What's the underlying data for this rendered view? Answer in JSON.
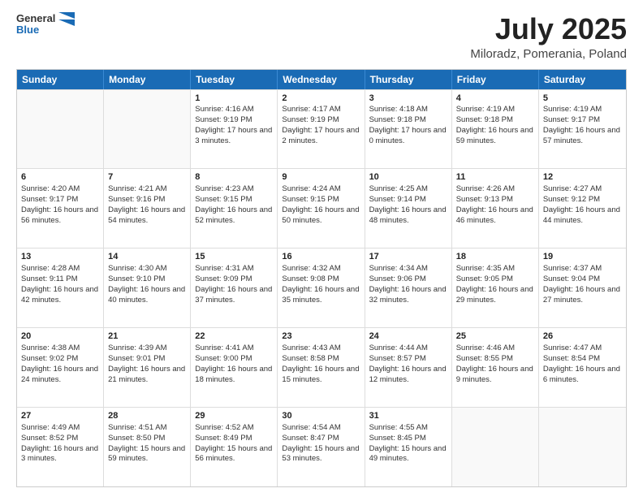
{
  "header": {
    "logo_line1": "General",
    "logo_line2": "Blue",
    "month": "July 2025",
    "location": "Miloradz, Pomerania, Poland"
  },
  "days_of_week": [
    "Sunday",
    "Monday",
    "Tuesday",
    "Wednesday",
    "Thursday",
    "Friday",
    "Saturday"
  ],
  "weeks": [
    [
      {
        "day": "",
        "sunrise": "",
        "sunset": "",
        "daylight": "",
        "empty": true
      },
      {
        "day": "",
        "sunrise": "",
        "sunset": "",
        "daylight": "",
        "empty": true
      },
      {
        "day": "1",
        "sunrise": "Sunrise: 4:16 AM",
        "sunset": "Sunset: 9:19 PM",
        "daylight": "Daylight: 17 hours and 3 minutes.",
        "empty": false
      },
      {
        "day": "2",
        "sunrise": "Sunrise: 4:17 AM",
        "sunset": "Sunset: 9:19 PM",
        "daylight": "Daylight: 17 hours and 2 minutes.",
        "empty": false
      },
      {
        "day": "3",
        "sunrise": "Sunrise: 4:18 AM",
        "sunset": "Sunset: 9:18 PM",
        "daylight": "Daylight: 17 hours and 0 minutes.",
        "empty": false
      },
      {
        "day": "4",
        "sunrise": "Sunrise: 4:19 AM",
        "sunset": "Sunset: 9:18 PM",
        "daylight": "Daylight: 16 hours and 59 minutes.",
        "empty": false
      },
      {
        "day": "5",
        "sunrise": "Sunrise: 4:19 AM",
        "sunset": "Sunset: 9:17 PM",
        "daylight": "Daylight: 16 hours and 57 minutes.",
        "empty": false
      }
    ],
    [
      {
        "day": "6",
        "sunrise": "Sunrise: 4:20 AM",
        "sunset": "Sunset: 9:17 PM",
        "daylight": "Daylight: 16 hours and 56 minutes.",
        "empty": false
      },
      {
        "day": "7",
        "sunrise": "Sunrise: 4:21 AM",
        "sunset": "Sunset: 9:16 PM",
        "daylight": "Daylight: 16 hours and 54 minutes.",
        "empty": false
      },
      {
        "day": "8",
        "sunrise": "Sunrise: 4:23 AM",
        "sunset": "Sunset: 9:15 PM",
        "daylight": "Daylight: 16 hours and 52 minutes.",
        "empty": false
      },
      {
        "day": "9",
        "sunrise": "Sunrise: 4:24 AM",
        "sunset": "Sunset: 9:15 PM",
        "daylight": "Daylight: 16 hours and 50 minutes.",
        "empty": false
      },
      {
        "day": "10",
        "sunrise": "Sunrise: 4:25 AM",
        "sunset": "Sunset: 9:14 PM",
        "daylight": "Daylight: 16 hours and 48 minutes.",
        "empty": false
      },
      {
        "day": "11",
        "sunrise": "Sunrise: 4:26 AM",
        "sunset": "Sunset: 9:13 PM",
        "daylight": "Daylight: 16 hours and 46 minutes.",
        "empty": false
      },
      {
        "day": "12",
        "sunrise": "Sunrise: 4:27 AM",
        "sunset": "Sunset: 9:12 PM",
        "daylight": "Daylight: 16 hours and 44 minutes.",
        "empty": false
      }
    ],
    [
      {
        "day": "13",
        "sunrise": "Sunrise: 4:28 AM",
        "sunset": "Sunset: 9:11 PM",
        "daylight": "Daylight: 16 hours and 42 minutes.",
        "empty": false
      },
      {
        "day": "14",
        "sunrise": "Sunrise: 4:30 AM",
        "sunset": "Sunset: 9:10 PM",
        "daylight": "Daylight: 16 hours and 40 minutes.",
        "empty": false
      },
      {
        "day": "15",
        "sunrise": "Sunrise: 4:31 AM",
        "sunset": "Sunset: 9:09 PM",
        "daylight": "Daylight: 16 hours and 37 minutes.",
        "empty": false
      },
      {
        "day": "16",
        "sunrise": "Sunrise: 4:32 AM",
        "sunset": "Sunset: 9:08 PM",
        "daylight": "Daylight: 16 hours and 35 minutes.",
        "empty": false
      },
      {
        "day": "17",
        "sunrise": "Sunrise: 4:34 AM",
        "sunset": "Sunset: 9:06 PM",
        "daylight": "Daylight: 16 hours and 32 minutes.",
        "empty": false
      },
      {
        "day": "18",
        "sunrise": "Sunrise: 4:35 AM",
        "sunset": "Sunset: 9:05 PM",
        "daylight": "Daylight: 16 hours and 29 minutes.",
        "empty": false
      },
      {
        "day": "19",
        "sunrise": "Sunrise: 4:37 AM",
        "sunset": "Sunset: 9:04 PM",
        "daylight": "Daylight: 16 hours and 27 minutes.",
        "empty": false
      }
    ],
    [
      {
        "day": "20",
        "sunrise": "Sunrise: 4:38 AM",
        "sunset": "Sunset: 9:02 PM",
        "daylight": "Daylight: 16 hours and 24 minutes.",
        "empty": false
      },
      {
        "day": "21",
        "sunrise": "Sunrise: 4:39 AM",
        "sunset": "Sunset: 9:01 PM",
        "daylight": "Daylight: 16 hours and 21 minutes.",
        "empty": false
      },
      {
        "day": "22",
        "sunrise": "Sunrise: 4:41 AM",
        "sunset": "Sunset: 9:00 PM",
        "daylight": "Daylight: 16 hours and 18 minutes.",
        "empty": false
      },
      {
        "day": "23",
        "sunrise": "Sunrise: 4:43 AM",
        "sunset": "Sunset: 8:58 PM",
        "daylight": "Daylight: 16 hours and 15 minutes.",
        "empty": false
      },
      {
        "day": "24",
        "sunrise": "Sunrise: 4:44 AM",
        "sunset": "Sunset: 8:57 PM",
        "daylight": "Daylight: 16 hours and 12 minutes.",
        "empty": false
      },
      {
        "day": "25",
        "sunrise": "Sunrise: 4:46 AM",
        "sunset": "Sunset: 8:55 PM",
        "daylight": "Daylight: 16 hours and 9 minutes.",
        "empty": false
      },
      {
        "day": "26",
        "sunrise": "Sunrise: 4:47 AM",
        "sunset": "Sunset: 8:54 PM",
        "daylight": "Daylight: 16 hours and 6 minutes.",
        "empty": false
      }
    ],
    [
      {
        "day": "27",
        "sunrise": "Sunrise: 4:49 AM",
        "sunset": "Sunset: 8:52 PM",
        "daylight": "Daylight: 16 hours and 3 minutes.",
        "empty": false
      },
      {
        "day": "28",
        "sunrise": "Sunrise: 4:51 AM",
        "sunset": "Sunset: 8:50 PM",
        "daylight": "Daylight: 15 hours and 59 minutes.",
        "empty": false
      },
      {
        "day": "29",
        "sunrise": "Sunrise: 4:52 AM",
        "sunset": "Sunset: 8:49 PM",
        "daylight": "Daylight: 15 hours and 56 minutes.",
        "empty": false
      },
      {
        "day": "30",
        "sunrise": "Sunrise: 4:54 AM",
        "sunset": "Sunset: 8:47 PM",
        "daylight": "Daylight: 15 hours and 53 minutes.",
        "empty": false
      },
      {
        "day": "31",
        "sunrise": "Sunrise: 4:55 AM",
        "sunset": "Sunset: 8:45 PM",
        "daylight": "Daylight: 15 hours and 49 minutes.",
        "empty": false
      },
      {
        "day": "",
        "sunrise": "",
        "sunset": "",
        "daylight": "",
        "empty": true
      },
      {
        "day": "",
        "sunrise": "",
        "sunset": "",
        "daylight": "",
        "empty": true
      }
    ]
  ]
}
